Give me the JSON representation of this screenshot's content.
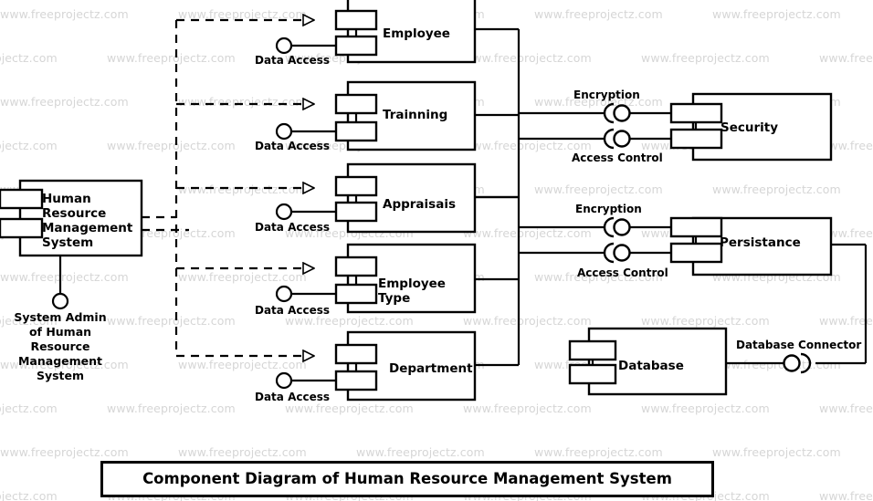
{
  "diagram": {
    "title": "Component Diagram of Human Resource Management System",
    "watermark_text": "www.freeprojectz.com"
  },
  "system_component": {
    "label": "Human\nResource\nManagement\nSystem"
  },
  "actor": {
    "label": "System Admin\nof Human\nResource\nManagement\nSystem"
  },
  "components": [
    {
      "name": "Employee",
      "interface": "Data Access"
    },
    {
      "name": "Trainning",
      "interface": "Data Access"
    },
    {
      "name": "Appraisais",
      "interface": "Data Access"
    },
    {
      "name": "Employee\nType",
      "interface": "Data Access"
    },
    {
      "name": "Department",
      "interface": "Data Access"
    }
  ],
  "services": [
    {
      "name": "Security",
      "interfaces": [
        {
          "label": "Encryption"
        },
        {
          "label": "Access Control"
        }
      ]
    },
    {
      "name": "Persistance",
      "interfaces": [
        {
          "label": "Encryption"
        },
        {
          "label": "Access Control"
        }
      ]
    }
  ],
  "database": {
    "name": "Database",
    "connector_label": "Database Connector"
  },
  "colors": {
    "stroke": "#000000",
    "fill": "#ffffff",
    "watermark": "#d6d6d6"
  }
}
